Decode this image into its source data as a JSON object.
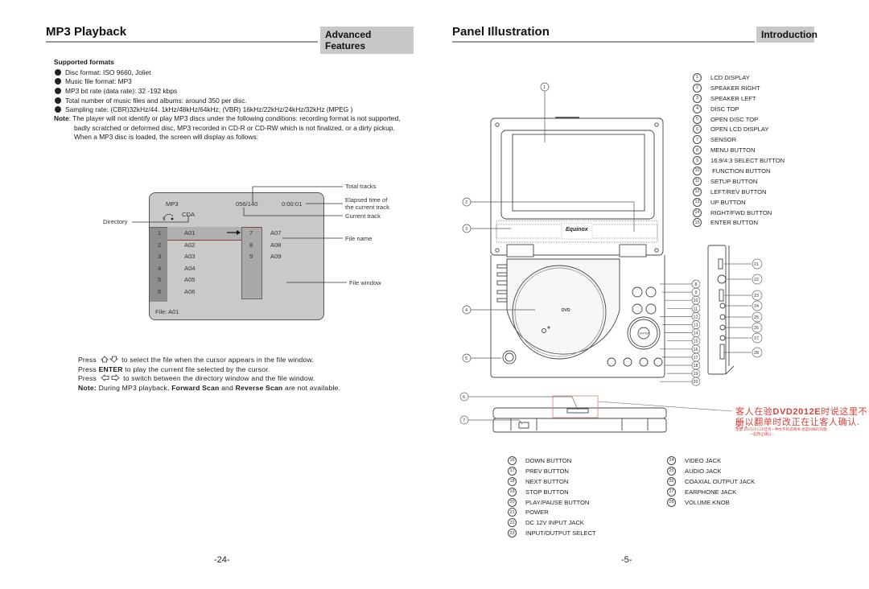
{
  "left_page": {
    "title": "MP3 Playback",
    "section_tab": "Advanced Features",
    "supported_heading": "Supported formats",
    "bullets": [
      "Disc format: ISO 9660, Joliet",
      "Music file format: MP3",
      "MP3 bit rate (data rate): 32 -192 kbps",
      "Total number of music files and albums: around 350 per disc.",
      "Sampling rate: (CBR)32kHz/44. 1kHz/48kHz/64kHz; (VBR) 16kHz/22kHz/24kHz/32kHz (MPEG )"
    ],
    "note_label": "Note",
    "note_lines": [
      ": The player will not identify or play MP3 discs under the following conditions: recording format is not supported,",
      "badly scratched or deformed disc, MP3 recorded in CD-R or CD-RW which is not finalized, or a dirty pickup.",
      "When a MP3 disc is loaded, the screen will display as follows:"
    ],
    "screen": {
      "mode": "MP3",
      "directory_name": "CDA",
      "track_counter": "056/140",
      "elapsed": "0:00:01",
      "left_column": [
        {
          "num": "1",
          "name": "A01"
        },
        {
          "num": "2",
          "name": "A02"
        },
        {
          "num": "3",
          "name": "A03"
        },
        {
          "num": "4",
          "name": "A04"
        },
        {
          "num": "5",
          "name": "A05"
        },
        {
          "num": "6",
          "name": "A06"
        }
      ],
      "right_column": [
        {
          "num": "7",
          "name": "A07"
        },
        {
          "num": "8",
          "name": "A08"
        },
        {
          "num": "9",
          "name": "A09"
        }
      ],
      "file_status": "File: A01"
    },
    "callouts": {
      "total_tracks": "Total tracks",
      "elapsed_1": "Elapsed time of",
      "elapsed_2": "the current track",
      "current_track": "Current track",
      "directory": "Directory",
      "file_name": "File name",
      "file_window": "File window"
    },
    "instructions": {
      "press": "Press",
      "line1": "to select the file when the cursor appears in the file window.",
      "line2_key": "ENTER",
      "line2": "to play the current file selected by the cursor.",
      "line3": "to switch between the directory window and the file window.",
      "note_label": "Note:",
      "note_a": "During MP3 playback,",
      "note_b": "Forward Scan",
      "note_c": "and",
      "note_d": "Reverse Scan",
      "note_e": "are not available."
    },
    "page_number": "-24-"
  },
  "right_page": {
    "title": "Panel Illustration",
    "section_tab": "Introduction",
    "brand": "Equinox",
    "legend_top": [
      {
        "n": "1",
        "label": "LCD DISPLAY"
      },
      {
        "n": "2",
        "label": "SPEAKER RIGHT"
      },
      {
        "n": "3",
        "label": "SPEAKER LEFT"
      },
      {
        "n": "4",
        "label": "DISC TOP"
      },
      {
        "n": "5",
        "label": "OPEN DISC TOP"
      },
      {
        "n": "6",
        "label": "OPEN LCD DISPLAY"
      },
      {
        "n": "7",
        "label": "SENSOR"
      },
      {
        "n": "8",
        "label": "MENU BUTTON"
      },
      {
        "n": "9",
        "label": "16:9/4:3 SELECT BUTTON"
      },
      {
        "n": "10",
        "label": " FUNCTION BUTTON"
      },
      {
        "n": "11",
        "label": "SETUP BUTTON"
      },
      {
        "n": "12",
        "label": "LEFT/REV BUTTON"
      },
      {
        "n": "13",
        "label": "UP BUTTON"
      },
      {
        "n": "14",
        "label": "RIGHT/FWD BUTTON"
      },
      {
        "n": "15",
        "label": "ENTER BUTTON"
      }
    ],
    "legend_bottom_left": [
      {
        "n": "16",
        "label": "DOWN BUTTON"
      },
      {
        "n": "17",
        "label": "PREV BUTTON"
      },
      {
        "n": "18",
        "label": "NEXT BUTTON"
      },
      {
        "n": "19",
        "label": "STOP BUTTON"
      },
      {
        "n": "20",
        "label": "PLAY/PAUSE BUTTON"
      },
      {
        "n": "21",
        "label": "POWER"
      },
      {
        "n": "22",
        "label": "DC 12V INPUT JACK"
      },
      {
        "n": "23",
        "label": "INPUT/OUTPUT SELECT"
      }
    ],
    "legend_bottom_right": [
      {
        "n": "24",
        "label": "VIDEO JACK"
      },
      {
        "n": "25",
        "label": "AUDIO JACK"
      },
      {
        "n": "26",
        "label": "COAXIAL OUTPUT JACK"
      },
      {
        "n": "27",
        "label": "EARPHONE JACK"
      },
      {
        "n": "28",
        "label": "VOLUME KNOB"
      }
    ],
    "annotation": {
      "line1_a": "客人在验",
      "line1_b": "DVD2012E",
      "line1_c": "时说这里不对,",
      "line2": "所以翻单时改正在让客人确认.",
      "small1": "注意:DVD2012E还有一种文字的说明书,也是同样的问题,",
      "small2": "一起改正确认--",
      "color": "#d8413a"
    },
    "page_number": "-5-"
  }
}
